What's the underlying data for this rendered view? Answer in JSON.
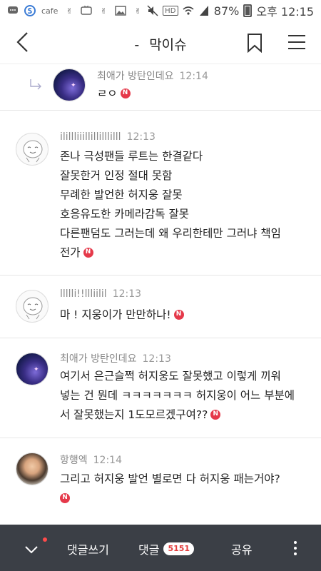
{
  "status_bar": {
    "cafe_label": "cafe",
    "battery_percent": "87%",
    "time": "오후 12:15"
  },
  "header": {
    "dash": "-",
    "title": "막이슈"
  },
  "comments": [
    {
      "author": "최애가 방탄인데요",
      "time": "12:14",
      "text_lines": [
        "ㄹㅇ"
      ],
      "badge": "N",
      "avatar": "night-sky",
      "is_reply": true
    },
    {
      "author": "ilillliiillillilllilll",
      "time": "12:13",
      "text_lines": [
        "존나 극성팬들 루트는 한결같다",
        "잘못한거 인정 절대 못함",
        "무례한 발언한 허지웅 잘못",
        "호응유도한 카메라감독 잘못",
        "다른팬덤도 그러는데 왜 우리한테만 그러냐 책임",
        "전가"
      ],
      "badge": "N",
      "avatar": "default-face"
    },
    {
      "author": "llllli!!llliilil",
      "time": "12:13",
      "text_lines": [
        "마 ! 지웅이가 만만하나!"
      ],
      "badge": "N",
      "avatar": "default-face"
    },
    {
      "author": "최애가 방탄인데요",
      "time": "12:13",
      "text_lines": [
        "여기서 은근슬쩍 허지웅도 잘못했고 이렇게 끼워",
        "넣는 건 뭔데 ㅋㅋㅋㅋㅋㅋㅋ 허지웅이 어느 부분에",
        "서 잘못했는지 1도모르겠구여??"
      ],
      "badge": "N",
      "avatar": "night-sky"
    },
    {
      "author": "항행엑",
      "time": "12:14",
      "text_lines": [
        "그리고 허지웅 발언 별로면 다 허지웅 패는거야?"
      ],
      "badge": "N",
      "avatar": "photo"
    }
  ],
  "bottom_bar": {
    "write_label": "댓글쓰기",
    "comments_label": "댓글",
    "comments_count": "5151",
    "share_label": "공유"
  },
  "colors": {
    "badge_red": "#e5394a",
    "bottom_bar_bg": "#3b3f46"
  }
}
